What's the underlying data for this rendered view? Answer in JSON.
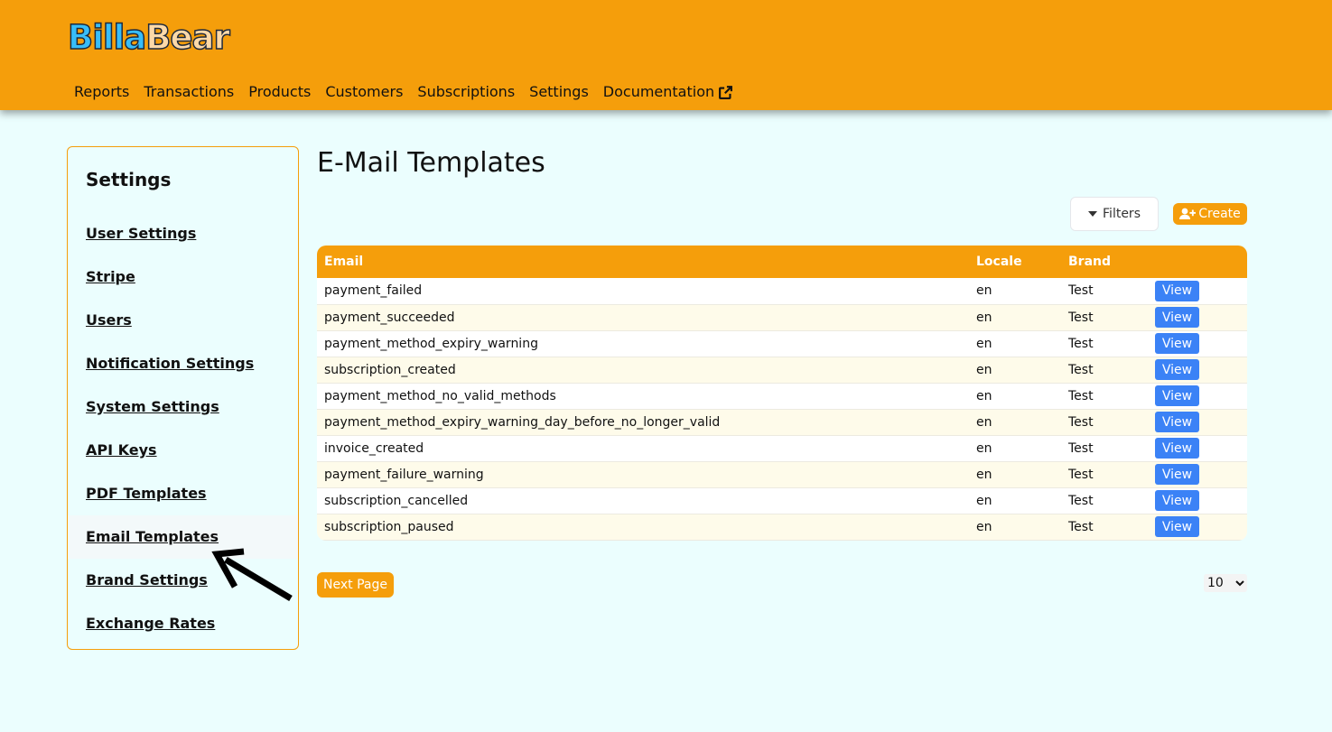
{
  "header": {
    "logo": {
      "part1": "Billa",
      "part2": "Bear"
    },
    "nav": [
      {
        "label": "Reports"
      },
      {
        "label": "Transactions"
      },
      {
        "label": "Products"
      },
      {
        "label": "Customers"
      },
      {
        "label": "Subscriptions"
      },
      {
        "label": "Settings"
      },
      {
        "label": "Documentation",
        "icon": "external-link-icon"
      }
    ]
  },
  "sidebar": {
    "title": "Settings",
    "items": [
      {
        "label": "User Settings"
      },
      {
        "label": "Stripe"
      },
      {
        "label": "Users"
      },
      {
        "label": "Notification Settings"
      },
      {
        "label": "System Settings"
      },
      {
        "label": "API Keys"
      },
      {
        "label": "PDF Templates"
      },
      {
        "label": "Email Templates",
        "active": true
      },
      {
        "label": "Brand Settings"
      },
      {
        "label": "Exchange Rates"
      }
    ]
  },
  "main": {
    "title": "E-Mail Templates",
    "filters_label": "Filters",
    "create_label": "Create",
    "table": {
      "headers": {
        "email": "Email",
        "locale": "Locale",
        "brand": "Brand"
      },
      "view_label": "View",
      "rows": [
        {
          "email": "payment_failed",
          "locale": "en",
          "brand": "Test"
        },
        {
          "email": "payment_succeeded",
          "locale": "en",
          "brand": "Test"
        },
        {
          "email": "payment_method_expiry_warning",
          "locale": "en",
          "brand": "Test"
        },
        {
          "email": "subscription_created",
          "locale": "en",
          "brand": "Test"
        },
        {
          "email": "payment_method_no_valid_methods",
          "locale": "en",
          "brand": "Test"
        },
        {
          "email": "payment_method_expiry_warning_day_before_no_longer_valid",
          "locale": "en",
          "brand": "Test"
        },
        {
          "email": "invoice_created",
          "locale": "en",
          "brand": "Test"
        },
        {
          "email": "payment_failure_warning",
          "locale": "en",
          "brand": "Test"
        },
        {
          "email": "subscription_cancelled",
          "locale": "en",
          "brand": "Test"
        },
        {
          "email": "subscription_paused",
          "locale": "en",
          "brand": "Test"
        }
      ]
    },
    "next_page_label": "Next Page",
    "per_page": {
      "selected": "10"
    }
  },
  "colors": {
    "accent": "#f59e0b",
    "view_button": "#3b82f6",
    "background": "#ebfefe"
  }
}
